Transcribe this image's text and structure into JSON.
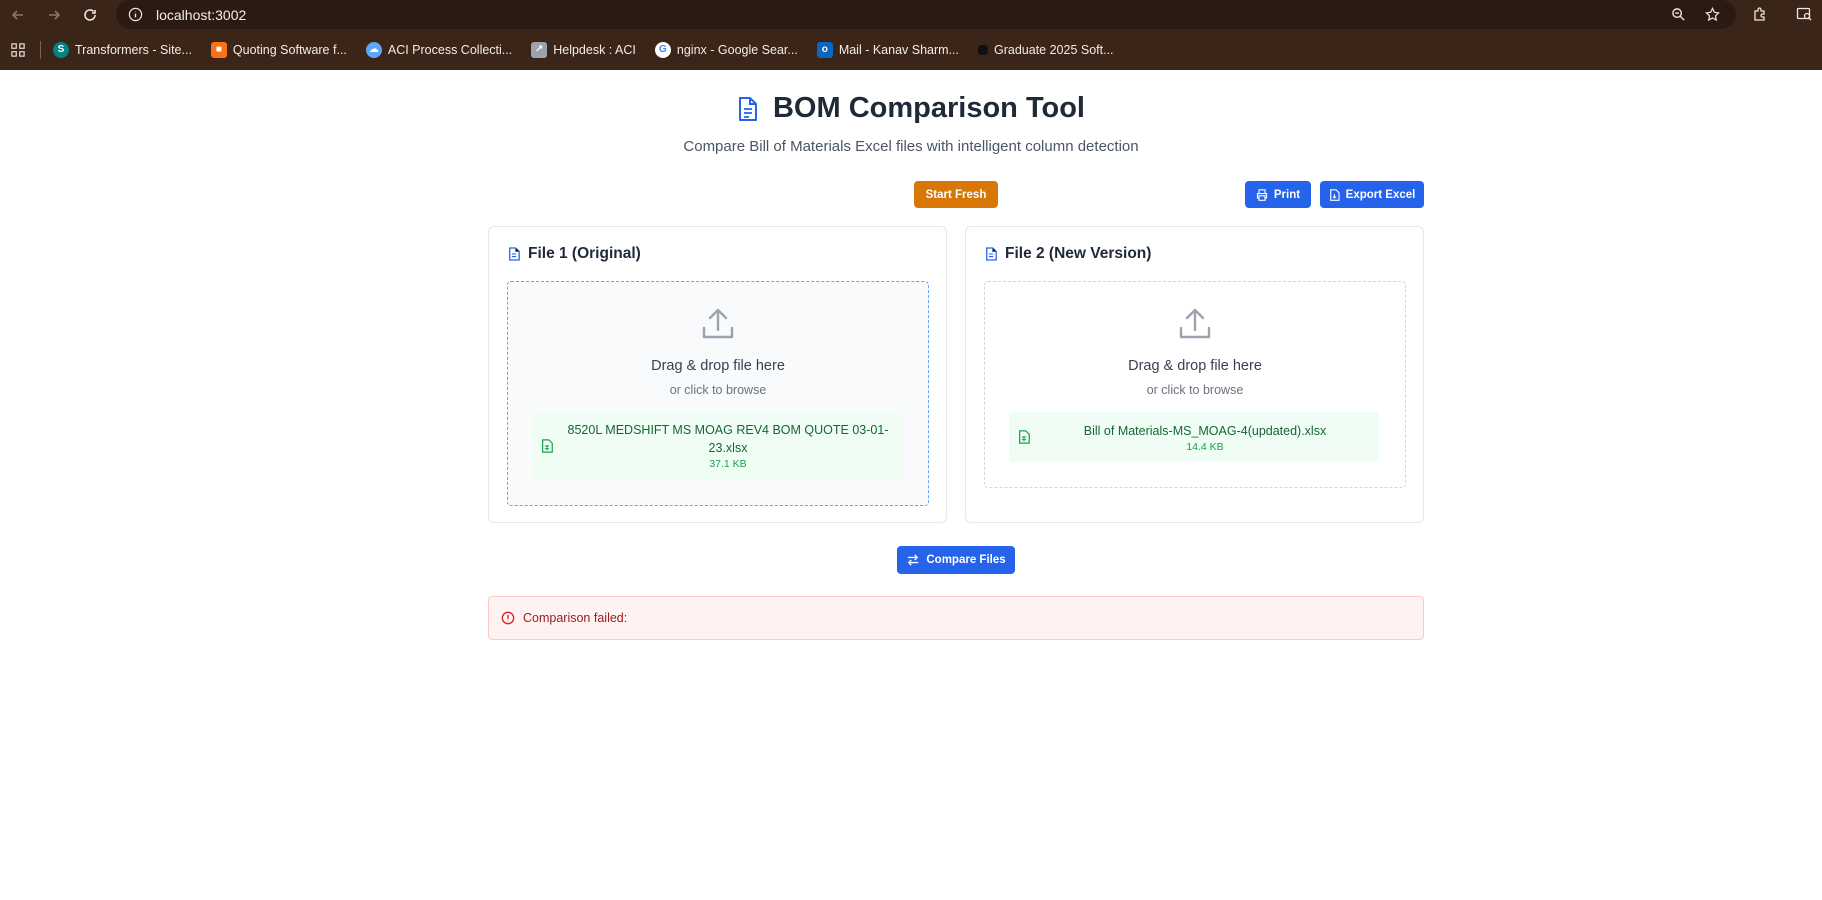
{
  "browser": {
    "url": "localhost:3002",
    "bookmarks": [
      {
        "label": "Transformers - Site...",
        "icon": "sharepoint-icon",
        "color": "#038387"
      },
      {
        "label": "Quoting Software f...",
        "icon": "box-icon",
        "color": "#f97316"
      },
      {
        "label": "ACI Process Collecti...",
        "icon": "cloud-icon",
        "color": "#60a5fa"
      },
      {
        "label": "Helpdesk : ACI",
        "icon": "helpdesk-icon",
        "color": "#9ca3af"
      },
      {
        "label": "nginx - Google Sear...",
        "icon": "google-icon",
        "color": "#ffffff"
      },
      {
        "label": "Mail - Kanav Sharm...",
        "icon": "outlook-icon",
        "color": "#0a66c2"
      },
      {
        "label": "Graduate 2025 Soft...",
        "icon": "square-icon",
        "color": "#111111"
      }
    ]
  },
  "header": {
    "title": "BOM Comparison Tool",
    "subtitle": "Compare Bill of Materials Excel files with intelligent column detection"
  },
  "actions": {
    "start_fresh": "Start Fresh",
    "print": "Print",
    "export_excel": "Export Excel",
    "compare": "Compare Files"
  },
  "file1": {
    "title": "File 1 (Original)",
    "drop_title": "Drag & drop file here",
    "drop_sub": "or click to browse",
    "file_name": "8520L MEDSHIFT MS MOAG REV4 BOM QUOTE 03-01-23.xlsx",
    "file_size": "37.1 KB"
  },
  "file2": {
    "title": "File 2 (New Version)",
    "drop_title": "Drag & drop file here",
    "drop_sub": "or click to browse",
    "file_name": "Bill of Materials-MS_MOAG-4(updated).xlsx",
    "file_size": "14.4 KB"
  },
  "error": {
    "message": "Comparison failed:"
  },
  "colors": {
    "accent": "#2563eb",
    "warning": "#d97706",
    "success": "#16a34a",
    "error": "#dc2626"
  }
}
